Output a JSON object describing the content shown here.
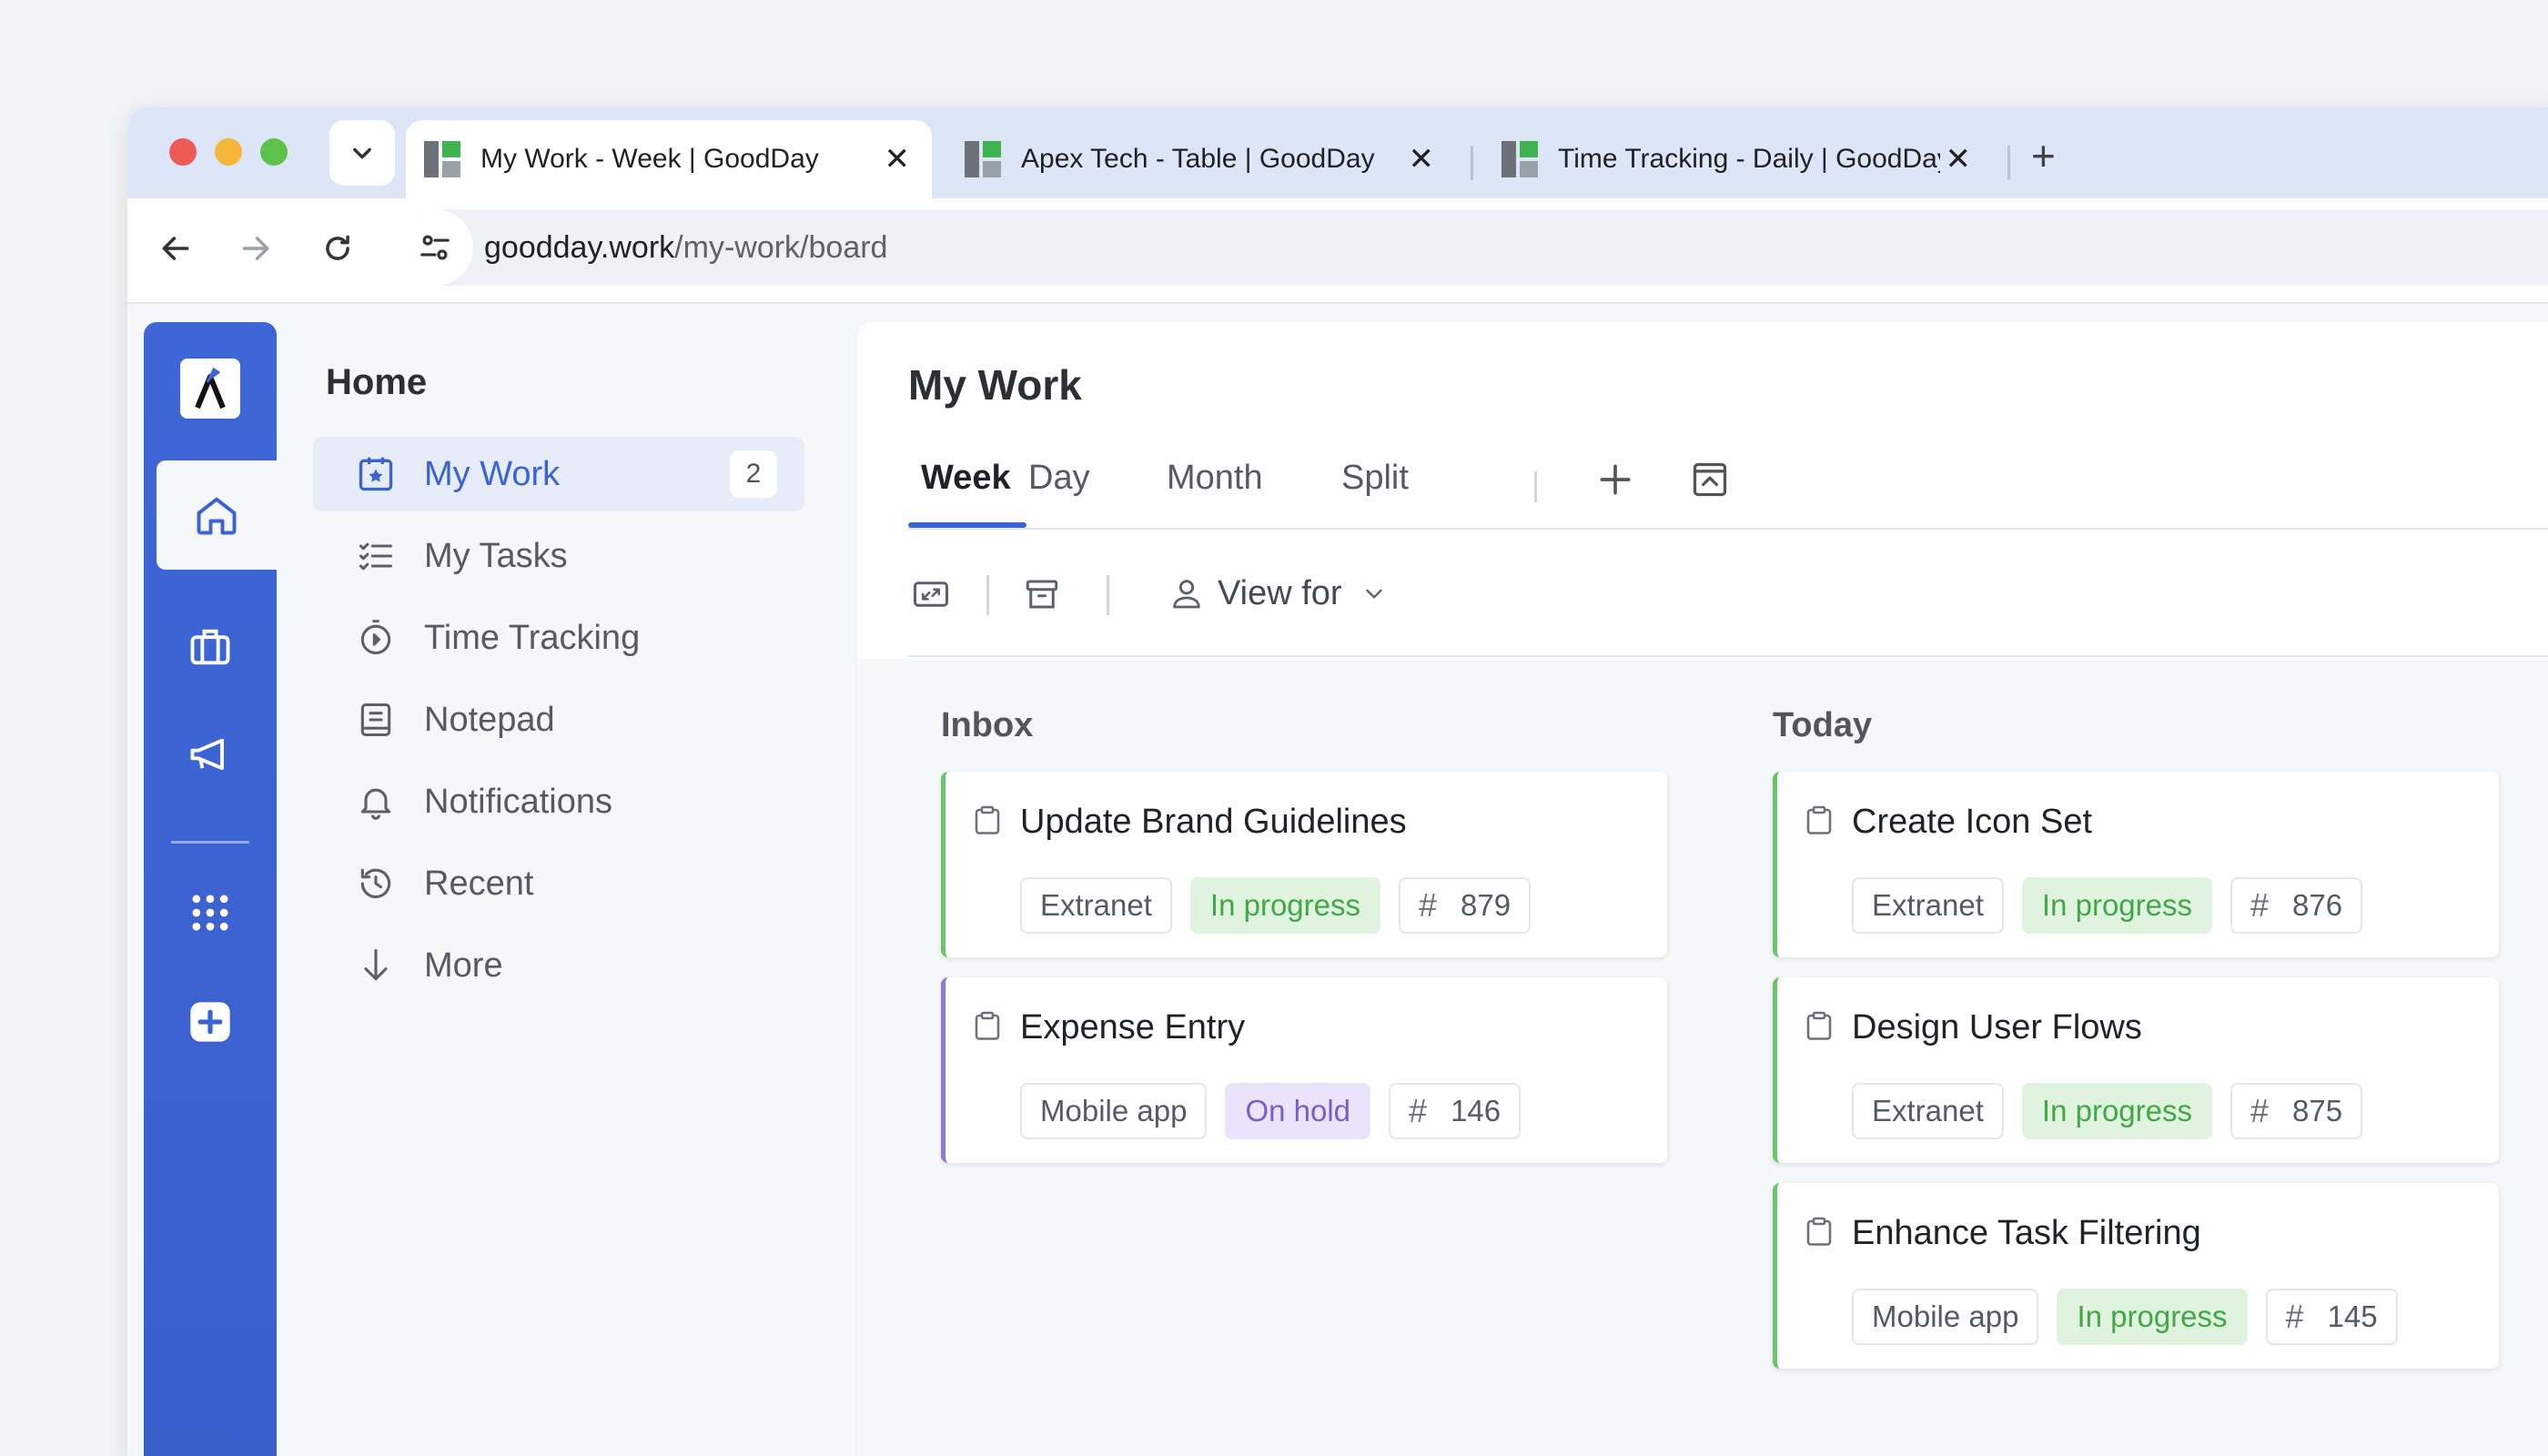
{
  "browser": {
    "tabs": [
      {
        "title": "My Work - Week | GoodDay",
        "close": "✕",
        "active": true
      },
      {
        "title": "Apex Tech - Table | GoodDay",
        "close": "✕",
        "active": false
      },
      {
        "title": "Time Tracking - Daily | GoodDay",
        "close": "✕",
        "active": false
      }
    ],
    "new_tab": "+",
    "url_host": "goodday.work",
    "url_path": "/my-work/board"
  },
  "sidebar": {
    "title": "Home",
    "items": [
      {
        "label": "My Work",
        "icon": "star-calendar-icon",
        "count": "2",
        "active": true
      },
      {
        "label": "My Tasks",
        "icon": "checklist-icon"
      },
      {
        "label": "Time Tracking",
        "icon": "timer-icon"
      },
      {
        "label": "Notepad",
        "icon": "notepad-icon"
      },
      {
        "label": "Notifications",
        "icon": "bell-icon"
      },
      {
        "label": "Recent",
        "icon": "history-icon"
      },
      {
        "label": "More",
        "icon": "arrow-down-icon"
      }
    ]
  },
  "main": {
    "title": "My Work",
    "tabs": [
      "Week",
      "Day",
      "Month",
      "Split"
    ],
    "active_tab": "Week",
    "view_for_label": "View for"
  },
  "board": {
    "columns": [
      {
        "title": "Inbox",
        "cards": [
          {
            "title": "Update Brand Guidelines",
            "project": "Extranet",
            "status": "In progress",
            "id": "879"
          },
          {
            "title": "Expense Entry",
            "project": "Mobile app",
            "status": "On hold",
            "id": "146"
          }
        ]
      },
      {
        "title": "Today",
        "cards": [
          {
            "title": "Create Icon Set",
            "project": "Extranet",
            "status": "In progress",
            "id": "876"
          },
          {
            "title": "Design User Flows",
            "project": "Extranet",
            "status": "In progress",
            "id": "875"
          },
          {
            "title": "Enhance Task Filtering",
            "project": "Mobile app",
            "status": "In progress",
            "id": "145"
          }
        ]
      }
    ]
  },
  "colors": {
    "accent": "#3c63d3",
    "rail": "#3d66d6",
    "in_progress": "#42a847",
    "on_hold": "#7460c9"
  }
}
